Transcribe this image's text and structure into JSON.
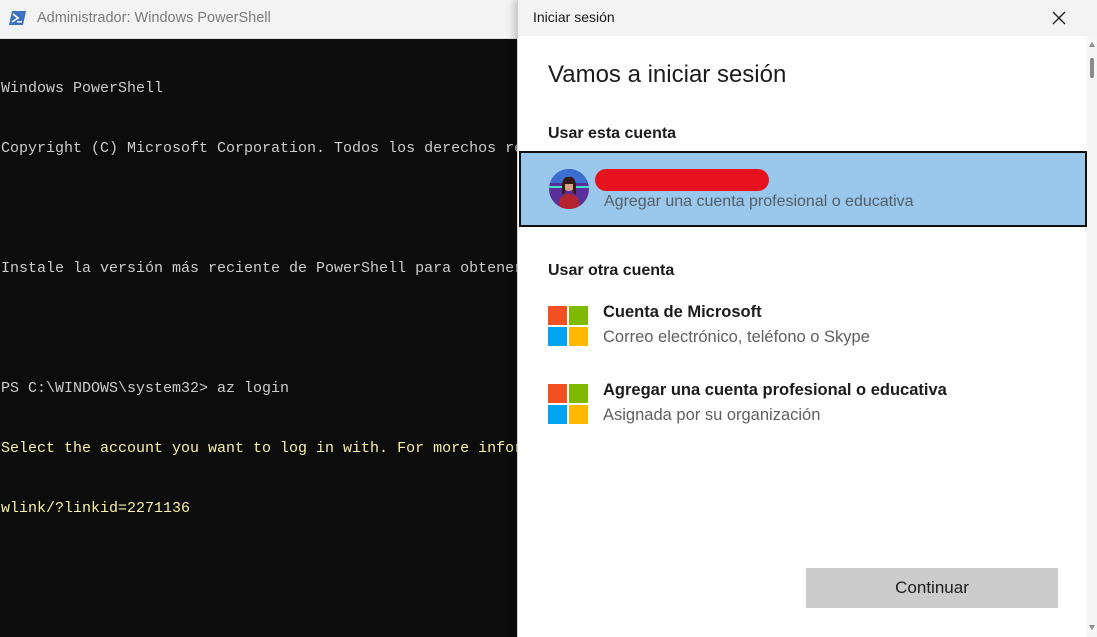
{
  "powershell": {
    "title": "Administrador: Windows PowerShell",
    "lines": [
      {
        "text": "Windows PowerShell",
        "color": "default"
      },
      {
        "text": "Copyright (C) Microsoft Corporation. Todos los derechos re",
        "color": "default"
      },
      {
        "text": "",
        "color": "default"
      },
      {
        "text": "Instale la versión más reciente de PowerShell para obtener",
        "color": "default"
      },
      {
        "text": "",
        "color": "default"
      },
      {
        "text": "PS C:\\WINDOWS\\system32> az login",
        "color": "default"
      },
      {
        "text": "Select the account you want to log in with. For more infor",
        "color": "yellow"
      },
      {
        "text": "wlink/?linkid=2271136",
        "color": "yellow"
      }
    ]
  },
  "signin": {
    "window_title": "Iniciar sesión",
    "heading": "Vamos a iniciar sesión",
    "use_this_account_label": "Usar esta cuenta",
    "current_account": {
      "name_redacted": true,
      "subtitle": "Agregar una cuenta profesional o educativa"
    },
    "use_other_account_label": "Usar otra cuenta",
    "options": [
      {
        "title": "Cuenta de Microsoft",
        "subtitle": "Correo electrónico, teléfono o Skype",
        "icon": "microsoft-logo-icon"
      },
      {
        "title": "Agregar una cuenta profesional o educativa",
        "subtitle": "Asignada por su organización",
        "icon": "microsoft-logo-icon"
      }
    ],
    "continue_label": "Continuar"
  },
  "colors": {
    "console_background": "#0c0c0c",
    "console_text": "#cccccc",
    "console_yellow": "#f9f1a5",
    "selected_account_background": "#99c8ec",
    "redaction": "#e8111e",
    "button_background": "#cccccc"
  }
}
